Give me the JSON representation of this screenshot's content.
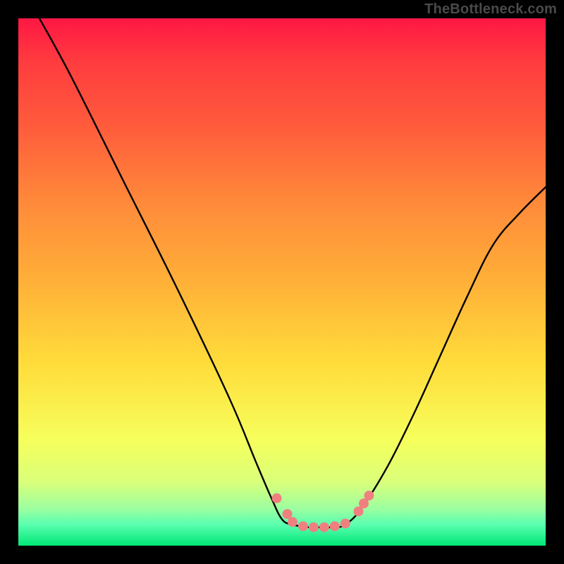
{
  "watermark": "TheBottleneck.com",
  "colors": {
    "curve_stroke": "#000000",
    "marker_fill": "#f08080",
    "marker_stroke": "#c96b6b",
    "frame_bg": "#000000"
  },
  "chart_data": {
    "type": "line",
    "title": "",
    "xlabel": "",
    "ylabel": "",
    "xlim": [
      0,
      100
    ],
    "ylim": [
      0,
      100
    ],
    "grid": false,
    "legend": false,
    "series": [
      {
        "name": "left-curve",
        "x": [
          4,
          10,
          20,
          30,
          40,
          45,
          48,
          50,
          52
        ],
        "values": [
          100,
          89,
          69,
          49,
          28,
          16,
          9,
          5,
          4
        ]
      },
      {
        "name": "valley-flat",
        "x": [
          52,
          55,
          58,
          60,
          62
        ],
        "values": [
          4,
          3.5,
          3.5,
          3.5,
          4
        ]
      },
      {
        "name": "right-curve",
        "x": [
          62,
          65,
          70,
          75,
          80,
          85,
          90,
          95,
          100
        ],
        "values": [
          4,
          7,
          15,
          25,
          36,
          47,
          57,
          63,
          68
        ]
      }
    ],
    "markers": [
      {
        "x": 49,
        "y": 9
      },
      {
        "x": 51,
        "y": 6
      },
      {
        "x": 52,
        "y": 4.5
      },
      {
        "x": 54,
        "y": 3.7
      },
      {
        "x": 56,
        "y": 3.5
      },
      {
        "x": 58,
        "y": 3.5
      },
      {
        "x": 60,
        "y": 3.7
      },
      {
        "x": 62,
        "y": 4.2
      },
      {
        "x": 64.5,
        "y": 6.5
      },
      {
        "x": 65.5,
        "y": 8
      },
      {
        "x": 66.5,
        "y": 9.5
      }
    ]
  }
}
